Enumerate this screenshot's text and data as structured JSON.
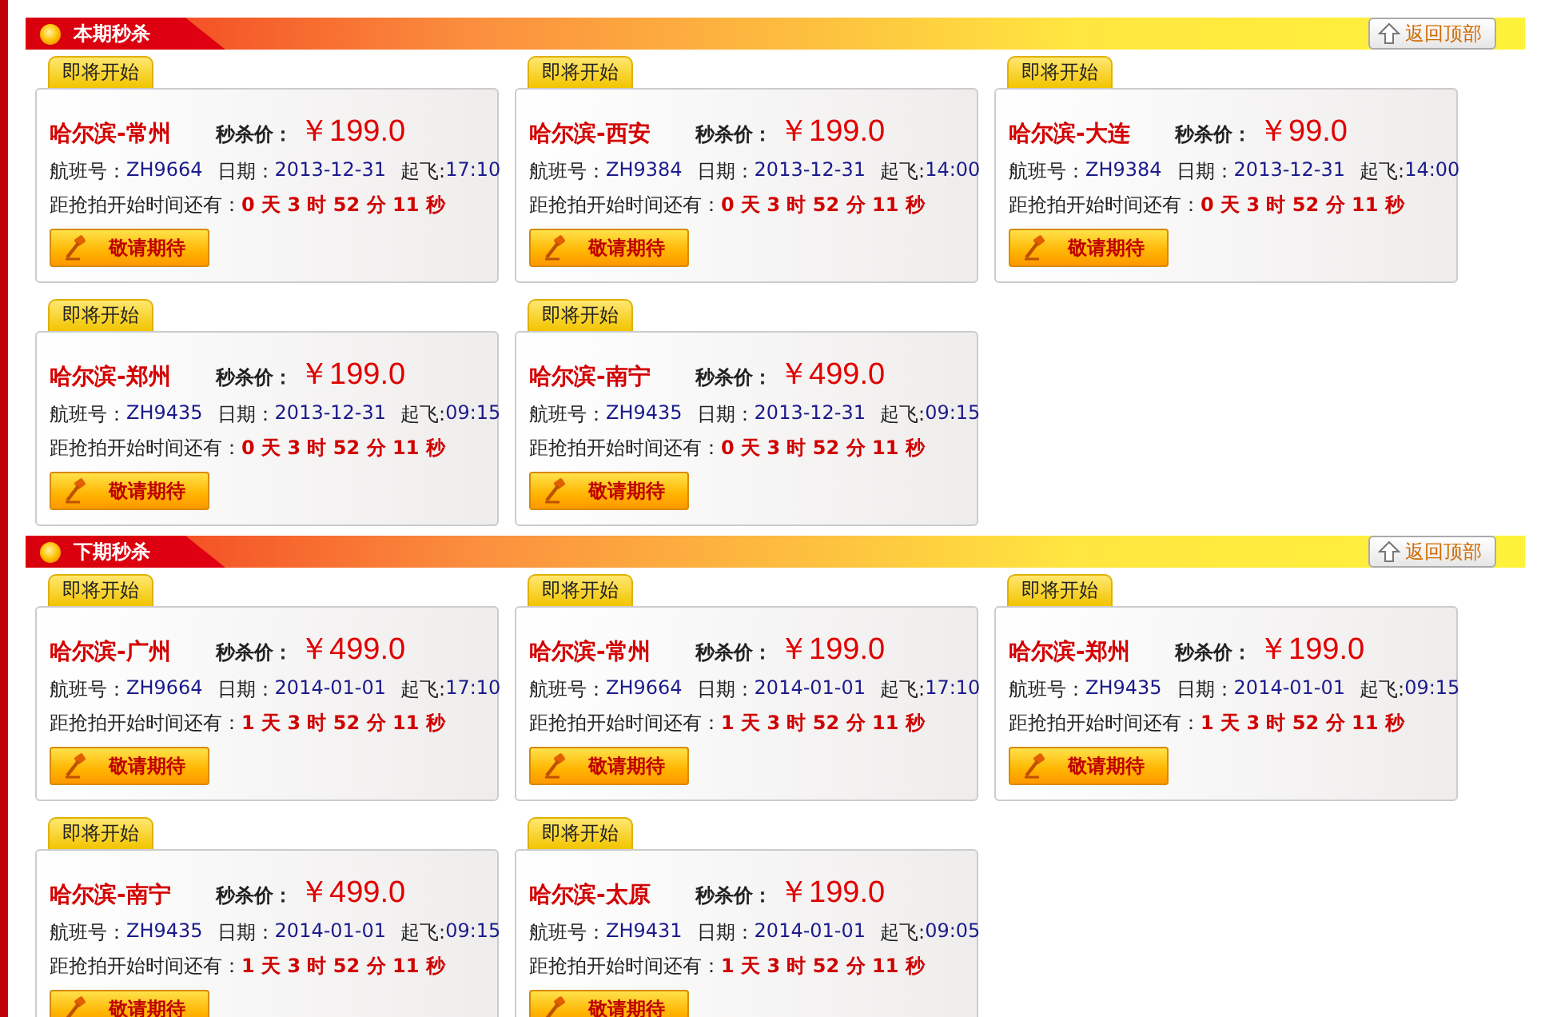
{
  "sections": [
    {
      "title": "本期秒杀",
      "back_button": "返回顶部",
      "flights": [
        {
          "tag": "即将开始",
          "route": "哈尔滨-常州",
          "price_label": "秒杀价：",
          "price": "￥199.0",
          "flight_label": "航班号：",
          "flight_no": "ZH9664",
          "date_label": "日期：",
          "date": "2013-12-31",
          "depart_label": "起飞:",
          "depart": "17:10",
          "countdown_label": "距抢拍开始时间还有：",
          "countdown": "0 天 3 时 52 分 11 秒",
          "button": "敬请期待"
        },
        {
          "tag": "即将开始",
          "route": "哈尔滨-西安",
          "price_label": "秒杀价：",
          "price": "￥199.0",
          "flight_label": "航班号：",
          "flight_no": "ZH9384",
          "date_label": "日期：",
          "date": "2013-12-31",
          "depart_label": "起飞:",
          "depart": "14:00",
          "countdown_label": "距抢拍开始时间还有：",
          "countdown": "0 天 3 时 52 分 11 秒",
          "button": "敬请期待"
        },
        {
          "tag": "即将开始",
          "route": "哈尔滨-大连",
          "price_label": "秒杀价：",
          "price": "￥99.0",
          "flight_label": "航班号：",
          "flight_no": "ZH9384",
          "date_label": "日期：",
          "date": "2013-12-31",
          "depart_label": "起飞:",
          "depart": "14:00",
          "countdown_label": "距抢拍开始时间还有：",
          "countdown": "0 天 3 时 52 分 11 秒",
          "button": "敬请期待"
        },
        {
          "tag": "即将开始",
          "route": "哈尔滨-郑州",
          "price_label": "秒杀价：",
          "price": "￥199.0",
          "flight_label": "航班号：",
          "flight_no": "ZH9435",
          "date_label": "日期：",
          "date": "2013-12-31",
          "depart_label": "起飞:",
          "depart": "09:15",
          "countdown_label": "距抢拍开始时间还有：",
          "countdown": "0 天 3 时 52 分 11 秒",
          "button": "敬请期待"
        },
        {
          "tag": "即将开始",
          "route": "哈尔滨-南宁",
          "price_label": "秒杀价：",
          "price": "￥499.0",
          "flight_label": "航班号：",
          "flight_no": "ZH9435",
          "date_label": "日期：",
          "date": "2013-12-31",
          "depart_label": "起飞:",
          "depart": "09:15",
          "countdown_label": "距抢拍开始时间还有：",
          "countdown": "0 天 3 时 52 分 11 秒",
          "button": "敬请期待"
        }
      ]
    },
    {
      "title": "下期秒杀",
      "back_button": "返回顶部",
      "flights": [
        {
          "tag": "即将开始",
          "route": "哈尔滨-广州",
          "price_label": "秒杀价：",
          "price": "￥499.0",
          "flight_label": "航班号：",
          "flight_no": "ZH9664",
          "date_label": "日期：",
          "date": "2014-01-01",
          "depart_label": "起飞:",
          "depart": "17:10",
          "countdown_label": "距抢拍开始时间还有：",
          "countdown": "1 天 3 时 52 分 11 秒",
          "button": "敬请期待"
        },
        {
          "tag": "即将开始",
          "route": "哈尔滨-常州",
          "price_label": "秒杀价：",
          "price": "￥199.0",
          "flight_label": "航班号：",
          "flight_no": "ZH9664",
          "date_label": "日期：",
          "date": "2014-01-01",
          "depart_label": "起飞:",
          "depart": "17:10",
          "countdown_label": "距抢拍开始时间还有：",
          "countdown": "1 天 3 时 52 分 11 秒",
          "button": "敬请期待"
        },
        {
          "tag": "即将开始",
          "route": "哈尔滨-郑州",
          "price_label": "秒杀价：",
          "price": "￥199.0",
          "flight_label": "航班号：",
          "flight_no": "ZH9435",
          "date_label": "日期：",
          "date": "2014-01-01",
          "depart_label": "起飞:",
          "depart": "09:15",
          "countdown_label": "距抢拍开始时间还有：",
          "countdown": "1 天 3 时 52 分 11 秒",
          "button": "敬请期待"
        },
        {
          "tag": "即将开始",
          "route": "哈尔滨-南宁",
          "price_label": "秒杀价：",
          "price": "￥499.0",
          "flight_label": "航班号：",
          "flight_no": "ZH9435",
          "date_label": "日期：",
          "date": "2014-01-01",
          "depart_label": "起飞:",
          "depart": "09:15",
          "countdown_label": "距抢拍开始时间还有：",
          "countdown": "1 天 3 时 52 分 11 秒",
          "button": "敬请期待"
        },
        {
          "tag": "即将开始",
          "route": "哈尔滨-太原",
          "price_label": "秒杀价：",
          "price": "￥199.0",
          "flight_label": "航班号：",
          "flight_no": "ZH9431",
          "date_label": "日期：",
          "date": "2014-01-01",
          "depart_label": "起飞:",
          "depart": "09:05",
          "countdown_label": "距抢拍开始时间还有：",
          "countdown": "1 天 3 时 52 分 11 秒",
          "button": "敬请期待"
        }
      ]
    }
  ]
}
